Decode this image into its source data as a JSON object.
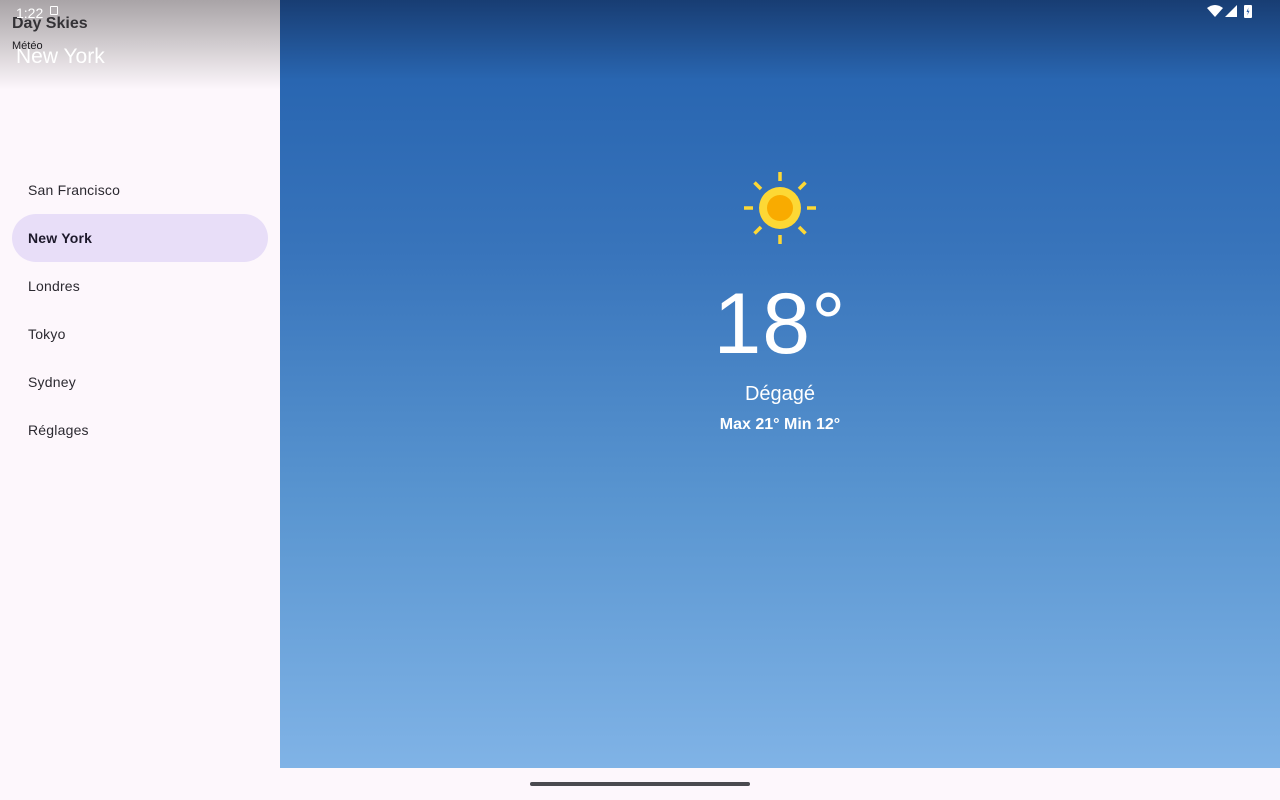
{
  "status_bar": {
    "time": "1:22"
  },
  "app": {
    "title": "Day Skies",
    "subtitle": "Météo",
    "header_city": "New York"
  },
  "nav": {
    "items": [
      {
        "label": "San Francisco",
        "selected": false
      },
      {
        "label": "New York",
        "selected": true
      },
      {
        "label": "Londres",
        "selected": false
      },
      {
        "label": "Tokyo",
        "selected": false
      },
      {
        "label": "Sydney",
        "selected": false
      },
      {
        "label": "Réglages",
        "selected": false
      }
    ]
  },
  "weather": {
    "icon": "sun-icon",
    "temperature": "18°",
    "condition": "Dégagé",
    "range": "Max 21° Min 12°"
  },
  "colors": {
    "sun_core": "#f9ab00",
    "sun_ring": "#fdd835",
    "nav_active": "#e8def8",
    "sky_top": "#183d73",
    "sky_bottom": "#80b3e6"
  }
}
